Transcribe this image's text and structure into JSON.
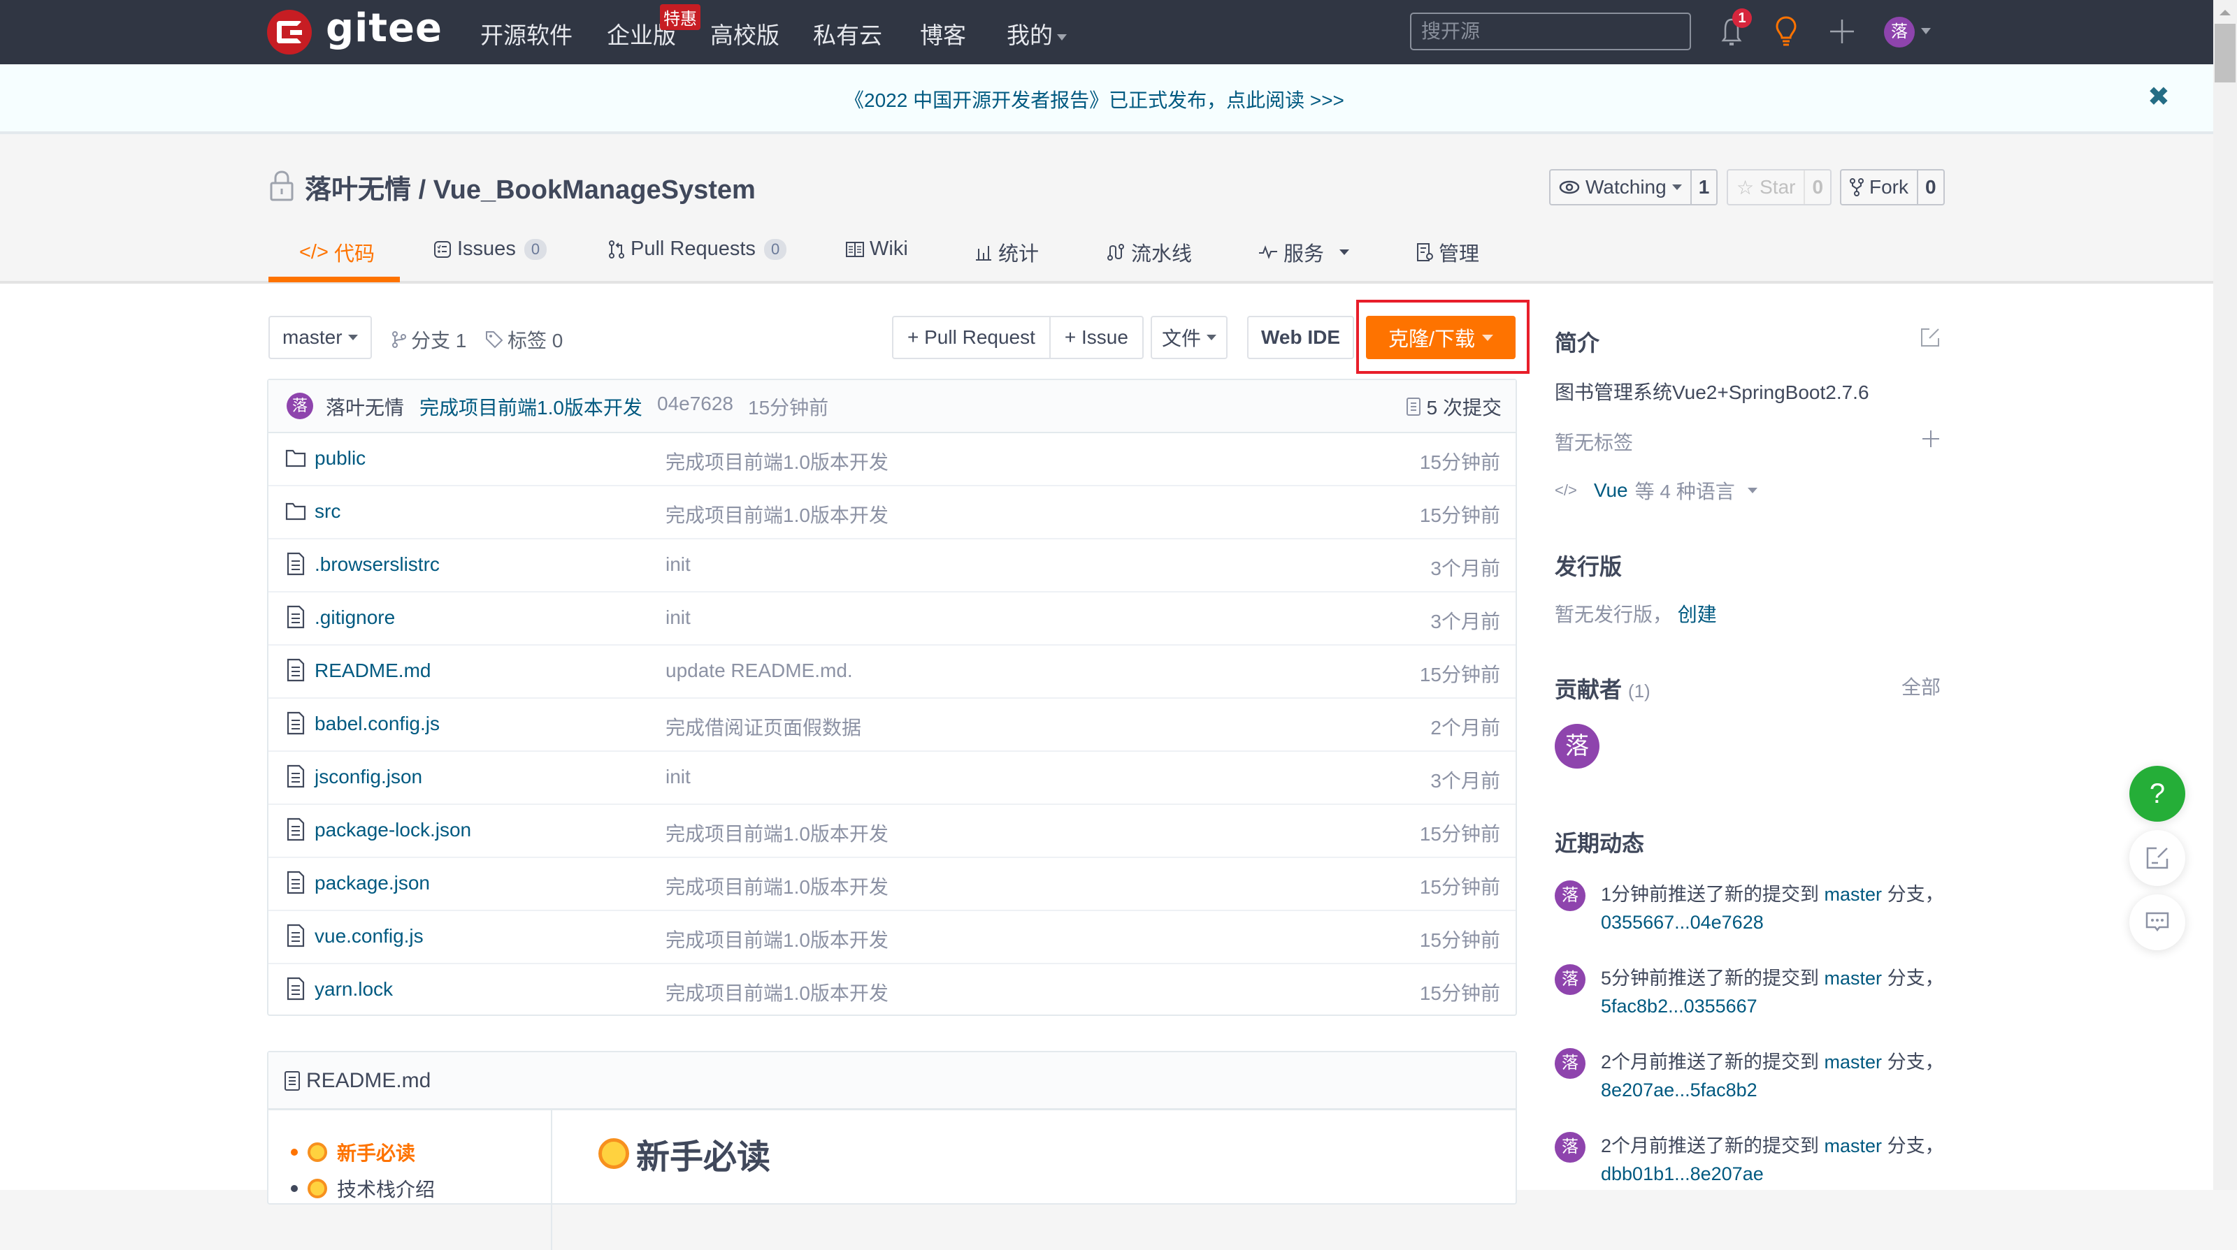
{
  "header": {
    "logo_text": "gitee",
    "nav": [
      {
        "label": "开源软件"
      },
      {
        "label": "企业版",
        "badge": "特惠"
      },
      {
        "label": "高校版"
      },
      {
        "label": "私有云"
      },
      {
        "label": "博客"
      },
      {
        "label": "我的",
        "dropdown": true
      }
    ],
    "search_placeholder": "搜开源",
    "notification_count": "1",
    "avatar_initial": "落",
    "icons": [
      "bell-icon",
      "lightbulb-icon",
      "plus-icon",
      "avatar"
    ]
  },
  "banner": {
    "text": "《2022 中国开源开发者报告》已正式发布，点此阅读 >>>",
    "close_icon": "✖"
  },
  "repo": {
    "owner": "落叶无情",
    "separator": " / ",
    "name": "Vue_BookManageSystem",
    "visibility_icon": "lock-icon",
    "watch": {
      "label": "Watching",
      "count": "1"
    },
    "star": {
      "label": "Star",
      "count": "0"
    },
    "fork": {
      "label": "Fork",
      "count": "0"
    }
  },
  "tabs": [
    {
      "label": "代码",
      "icon": "code-icon",
      "active": true
    },
    {
      "label": "Issues",
      "icon": "issues-icon",
      "count": "0"
    },
    {
      "label": "Pull Requests",
      "icon": "pull-request-icon",
      "count": "0"
    },
    {
      "label": "Wiki",
      "icon": "wiki-icon"
    },
    {
      "label": "统计",
      "icon": "stats-icon"
    },
    {
      "label": "流水线",
      "icon": "pipeline-icon"
    },
    {
      "label": "服务",
      "icon": "service-icon",
      "dropdown": true
    },
    {
      "label": "管理",
      "icon": "manage-icon"
    }
  ],
  "toolbar": {
    "branch": "master",
    "branches_label": "分支 1",
    "tags_label": "标签 0",
    "pull_request_btn": "+ Pull Request",
    "issue_btn": "+ Issue",
    "file_btn": "文件",
    "web_ide_btn": "Web IDE",
    "clone_btn": "克隆/下载"
  },
  "last_commit": {
    "avatar_initial": "落",
    "author": "落叶无情",
    "message": "完成项目前端1.0版本开发",
    "sha": "04e7628",
    "time": "15分钟前",
    "commit_count": "5 次提交"
  },
  "files": [
    {
      "name": "public",
      "type": "folder",
      "message": "完成项目前端1.0版本开发",
      "time": "15分钟前"
    },
    {
      "name": "src",
      "type": "folder",
      "message": "完成项目前端1.0版本开发",
      "time": "15分钟前"
    },
    {
      "name": ".browserslistrc",
      "type": "file",
      "message": "init",
      "time": "3个月前"
    },
    {
      "name": ".gitignore",
      "type": "file",
      "message": "init",
      "time": "3个月前"
    },
    {
      "name": "README.md",
      "type": "file",
      "message": "update README.md.",
      "time": "15分钟前"
    },
    {
      "name": "babel.config.js",
      "type": "file",
      "message": "完成借阅证页面假数据",
      "time": "2个月前"
    },
    {
      "name": "jsconfig.json",
      "type": "file",
      "message": "init",
      "time": "3个月前"
    },
    {
      "name": "package-lock.json",
      "type": "file",
      "message": "完成项目前端1.0版本开发",
      "time": "15分钟前"
    },
    {
      "name": "package.json",
      "type": "file",
      "message": "完成项目前端1.0版本开发",
      "time": "15分钟前"
    },
    {
      "name": "vue.config.js",
      "type": "file",
      "message": "完成项目前端1.0版本开发",
      "time": "15分钟前"
    },
    {
      "name": "yarn.lock",
      "type": "file",
      "message": "完成项目前端1.0版本开发",
      "time": "15分钟前"
    }
  ],
  "readme": {
    "filename": "README.md",
    "toc": [
      {
        "label": "新手必读",
        "active": true
      },
      {
        "label": "技术栈介绍",
        "active": false
      }
    ],
    "heading": "新手必读"
  },
  "sidebar": {
    "intro_title": "简介",
    "description": "图书管理系统Vue2+SpringBoot2.7.6",
    "no_tags": "暂无标签",
    "language_main": "Vue",
    "language_rest": "等 4 种语言",
    "releases_title": "发行版",
    "no_releases": "暂无发行版，",
    "create_link": "创建",
    "contributors_title": "贡献者",
    "contributors_count": "(1)",
    "contributors_all": "全部",
    "contributor_initial": "落",
    "activity_title": "近期动态",
    "activity": [
      {
        "prefix": "1分钟前推送了新的提交到 ",
        "branch": "master",
        "suffix": " 分支，",
        "range": "0355667...04e7628"
      },
      {
        "prefix": "5分钟前推送了新的提交到 ",
        "branch": "master",
        "suffix": " 分支，",
        "range": "5fac8b2...0355667"
      },
      {
        "prefix": "2个月前推送了新的提交到 ",
        "branch": "master",
        "suffix": " 分支，",
        "range": "8e207ae...5fac8b2"
      },
      {
        "prefix": "2个月前推送了新的提交到 ",
        "branch": "master",
        "suffix": " 分支，",
        "range": "dbb01b1...8e207ae"
      }
    ]
  },
  "floating": {
    "help": "?"
  },
  "colors": {
    "header_bg": "#303643",
    "accent_orange": "#fe7300",
    "link": "#005980",
    "avatar_purple": "#8e44ad",
    "help_green": "#25ae38",
    "highlight_red": "#e81e2a"
  }
}
